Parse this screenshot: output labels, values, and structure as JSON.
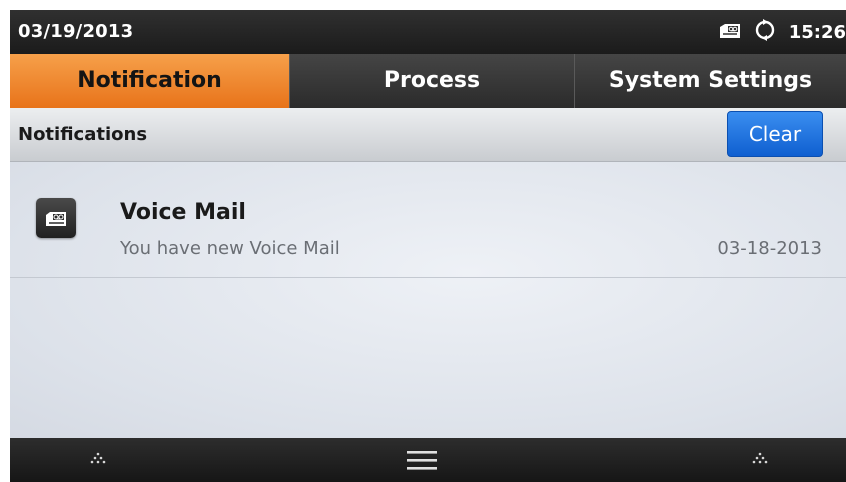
{
  "status_bar": {
    "date": "03/19/2013",
    "time": "15:26",
    "icons": [
      "voicemail-icon",
      "sync-icon"
    ]
  },
  "tabs": [
    {
      "label": "Notification",
      "active": true
    },
    {
      "label": "Process",
      "active": false
    },
    {
      "label": "System Settings",
      "active": false
    }
  ],
  "section": {
    "title": "Notifications",
    "clear_label": "Clear"
  },
  "notifications": [
    {
      "icon": "voicemail-icon",
      "title": "Voice Mail",
      "message": "You have new Voice Mail",
      "date": "03-18-2013"
    }
  ],
  "bottom_bar": {
    "icons": [
      "dots-triangle-icon",
      "menu-icon",
      "dots-triangle-icon"
    ]
  },
  "colors": {
    "accent_tab": "#e8731a",
    "clear_button": "#1a6fe0",
    "bar_dark": "#222222"
  }
}
